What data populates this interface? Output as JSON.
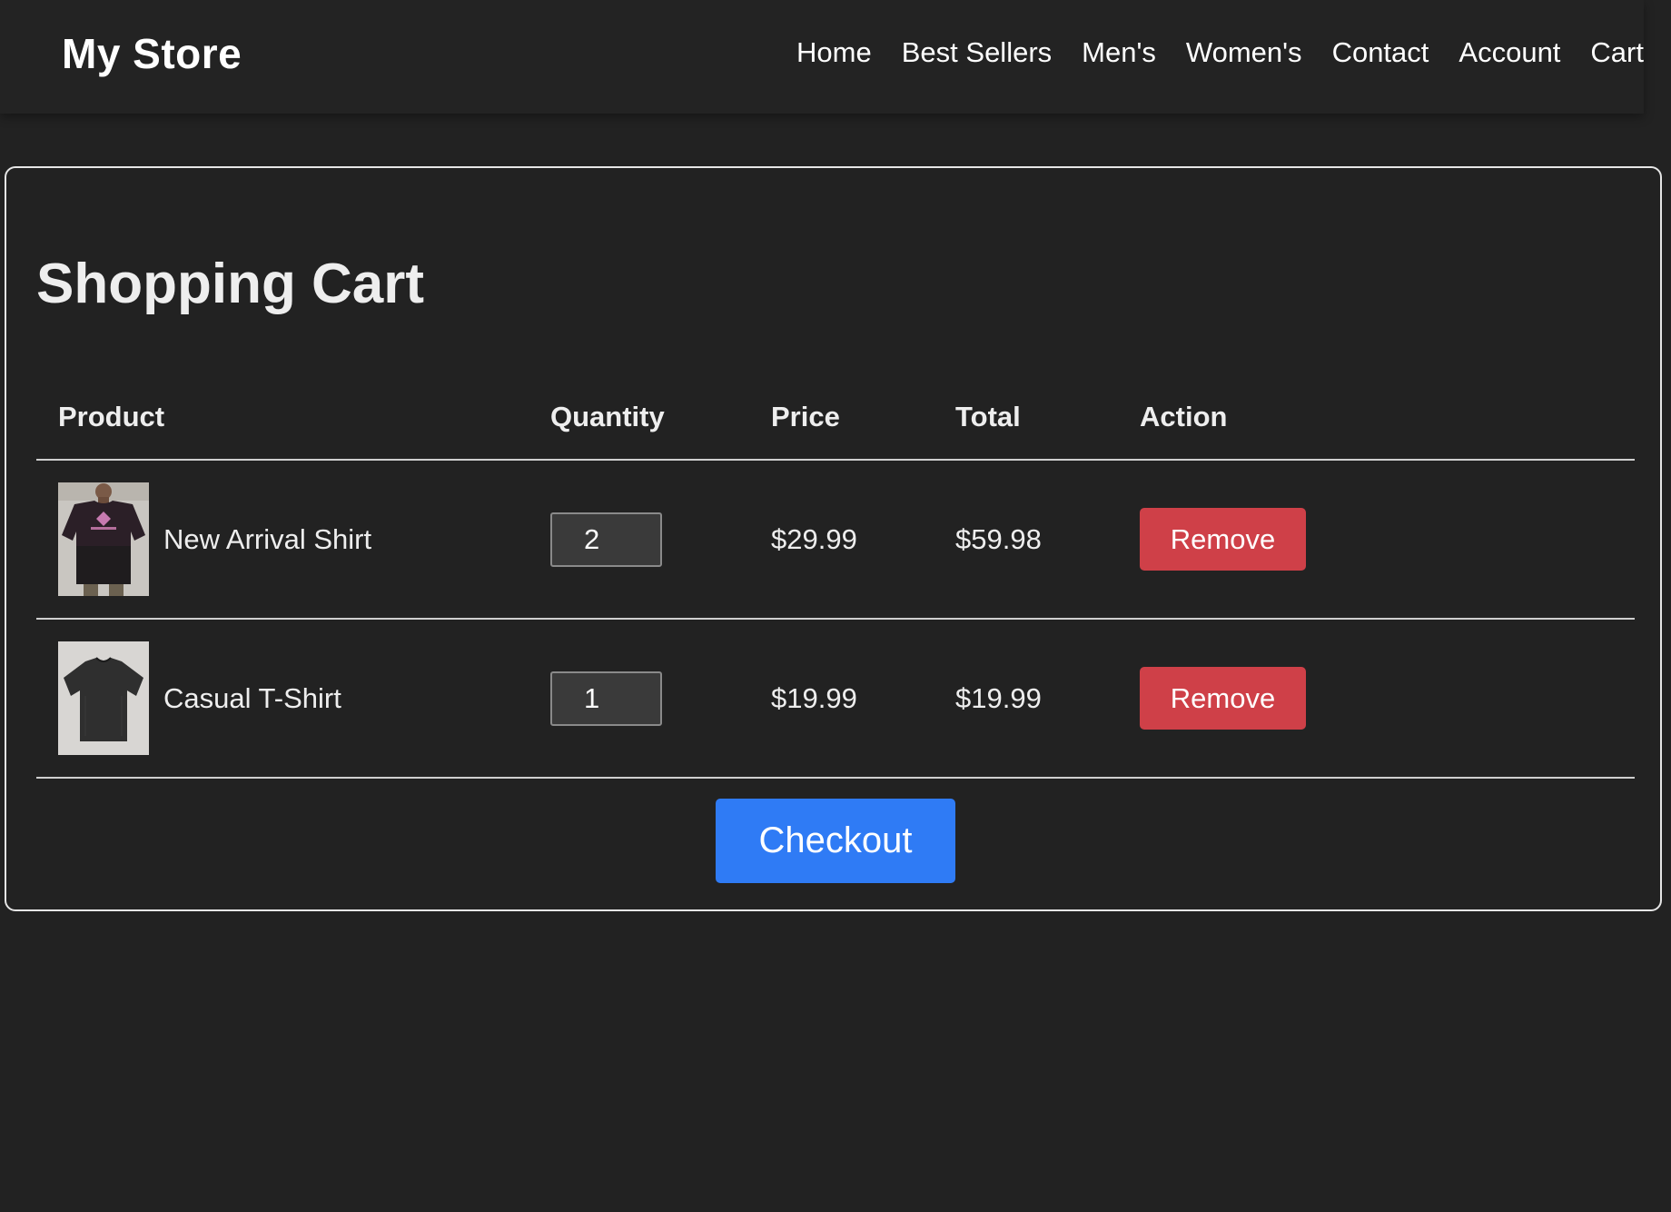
{
  "header": {
    "logo": "My Store",
    "nav": [
      "Home",
      "Best Sellers",
      "Men's",
      "Women's",
      "Contact",
      "Account",
      "Cart"
    ]
  },
  "cart": {
    "title": "Shopping Cart",
    "columns": {
      "product": "Product",
      "quantity": "Quantity",
      "price": "Price",
      "total": "Total",
      "action": "Action"
    },
    "items": [
      {
        "name": "New Arrival Shirt",
        "image_icon": "shirt-photo-icon",
        "quantity": "2",
        "price": "$29.99",
        "total": "$59.98",
        "action_label": "Remove"
      },
      {
        "name": "Casual T-Shirt",
        "image_icon": "tshirt-photo-icon",
        "quantity": "1",
        "price": "$19.99",
        "total": "$19.99",
        "action_label": "Remove"
      }
    ],
    "checkout_label": "Checkout"
  },
  "colors": {
    "background": "#222222",
    "remove_button": "#cf4048",
    "checkout_button": "#2f7bf5"
  }
}
